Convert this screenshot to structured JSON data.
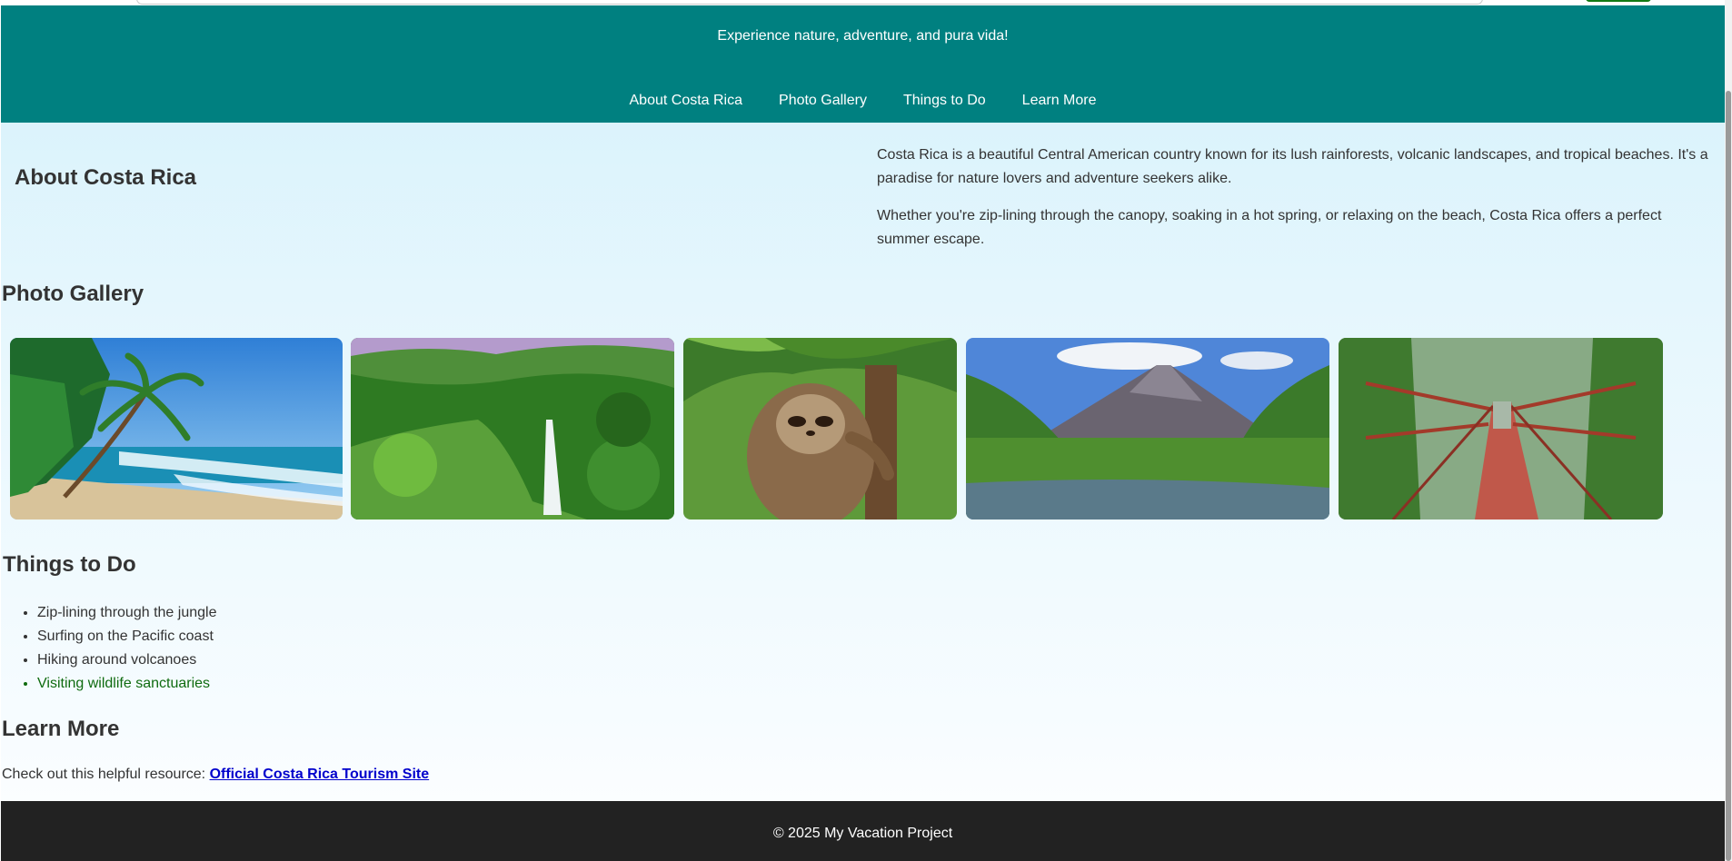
{
  "header": {
    "tagline": "Experience nature, adventure, and pura vida!",
    "nav": [
      "About Costa Rica",
      "Photo Gallery",
      "Things to Do",
      "Learn More"
    ]
  },
  "about": {
    "title": "About Costa Rica",
    "paragraphs": [
      "Costa Rica is a beautiful Central American country known for its lush rainforests, volcanic landscapes, and tropical beaches. It's a paradise for nature lovers and adventure seekers alike.",
      "Whether you're zip-lining through the canopy, soaking in a hot spring, or relaxing on the beach, Costa Rica offers a perfect summer escape."
    ]
  },
  "gallery": {
    "title": "Photo Gallery",
    "photos": [
      "beach-palm-photo",
      "waterfall-photo",
      "sloth-photo",
      "volcano-photo",
      "hanging-bridge-photo"
    ]
  },
  "things_to_do": {
    "title": "Things to Do",
    "items": [
      "Zip-lining through the jungle",
      "Surfing on the Pacific coast",
      "Hiking around volcanoes",
      "Visiting wildlife sanctuaries"
    ]
  },
  "learn_more": {
    "title": "Learn More",
    "text": "Check out this helpful resource:",
    "link_label": "Official Costa Rica Tourism Site"
  },
  "footer": {
    "text": "© 2025 My Vacation Project"
  },
  "colors": {
    "header_bg": "#008080",
    "footer_bg": "#222222",
    "link": "#0000cc",
    "highlight_item": "#0f6b0f"
  }
}
